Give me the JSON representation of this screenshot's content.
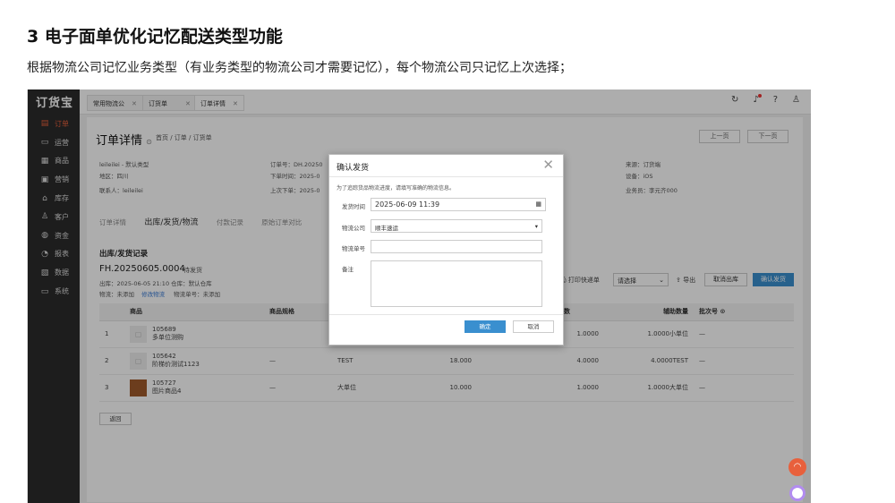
{
  "slide": {
    "title": "3 电子面单优化记忆配送类型功能",
    "subtitle": "根据物流公司记忆业务类型（有业务类型的物流公司才需要记忆），每个物流公司只记忆上次选择；"
  },
  "app": {
    "logo": "订货宝",
    "sidebar": [
      {
        "label": "订单",
        "icon": "▤"
      },
      {
        "label": "运营",
        "icon": "▭"
      },
      {
        "label": "商品",
        "icon": "▦"
      },
      {
        "label": "营销",
        "icon": "▣"
      },
      {
        "label": "库存",
        "icon": "⌂"
      },
      {
        "label": "客户",
        "icon": "♙"
      },
      {
        "label": "资金",
        "icon": "◍"
      },
      {
        "label": "报表",
        "icon": "◔"
      },
      {
        "label": "数据",
        "icon": "▧"
      },
      {
        "label": "系统",
        "icon": "▭"
      }
    ],
    "tabs": [
      {
        "label": "常用物流公",
        "close": "✕"
      },
      {
        "label": "订货单",
        "close": "✕"
      },
      {
        "label": "订单详情",
        "close": "✕"
      }
    ],
    "top_icons": {
      "refresh": "↻",
      "bell": "♪",
      "help": "?",
      "user": "♙"
    }
  },
  "page": {
    "title": "订单详情",
    "title_icon": "⊙",
    "breadcrumb": "首页 / 订单 / 订货单",
    "prev": "上一页",
    "next": "下一页",
    "info": {
      "customer": "leileilei - 默认类型",
      "region": "地区：四川",
      "contact": "联系人：leileilei",
      "order_no": "订单号：DH.20250",
      "order_time": "下单时间：2025-0",
      "last_order": "上次下单：2025-0",
      "source": "来源：订货端",
      "device": "设备：iOS",
      "salesman": "业务员：李元齐000"
    },
    "subtabs": [
      "订单详情",
      "出库/发货/物流",
      "付款记录",
      "原始订单对比"
    ],
    "section_title": "出库/发货记录",
    "record_no": "FH.20250605.0004",
    "record_status": "待发货",
    "record_meta": "出库：2025-06-05 21:10   仓库：默认仓库",
    "logistics_label": "物流：未添加",
    "modify_logistics": "修改物流",
    "logistics_no": "物流单号：未添加",
    "print_label": "打印快递单",
    "select_placeholder": "请选择",
    "export_label": "导出",
    "cancel_out": "取消出库",
    "confirm_ship": "确认发货",
    "table": {
      "headers": [
        "",
        "商品",
        "商品规格",
        "",
        "",
        "",
        "待发货数",
        "辅助数量",
        "批次号"
      ],
      "rows": [
        {
          "idx": "1",
          "code": "105689",
          "name": "多单位测购",
          "spec": "",
          "c4": "",
          "c5": "",
          "c6": "",
          "qty": "1.0000",
          "aux": "1.0000小单位",
          "batch": "—"
        },
        {
          "idx": "2",
          "code": "105642",
          "name": "阶梯价测试1123",
          "spec": "—",
          "c4": "TEST",
          "c5": "18.000",
          "c6": "",
          "qty": "4.0000",
          "aux": "4.0000TEST",
          "batch": "—"
        },
        {
          "idx": "3",
          "code": "105727",
          "name": "图片商品4",
          "spec": "—",
          "c4": "大单位",
          "c5": "10.000",
          "c6": "",
          "qty": "1.0000",
          "aux": "1.0000大单位",
          "batch": "—"
        }
      ]
    },
    "back": "返回"
  },
  "modal": {
    "title": "确认发货",
    "close": "✕",
    "hint": "为了追踪货品物流进度，请填写准确的物流信息。",
    "ship_time_label": "发货时间",
    "ship_time_value": "2025-06-09 11:39",
    "company_label": "物流公司",
    "company_value": "顺丰速运",
    "tracking_label": "物流单号",
    "tracking_value": "",
    "remark_label": "备注",
    "ok": "确定",
    "cancel": "取消"
  },
  "colors": {
    "accent": "#e8603c",
    "primary": "#3a8fcf",
    "sidebar": "#2b2b2b"
  }
}
